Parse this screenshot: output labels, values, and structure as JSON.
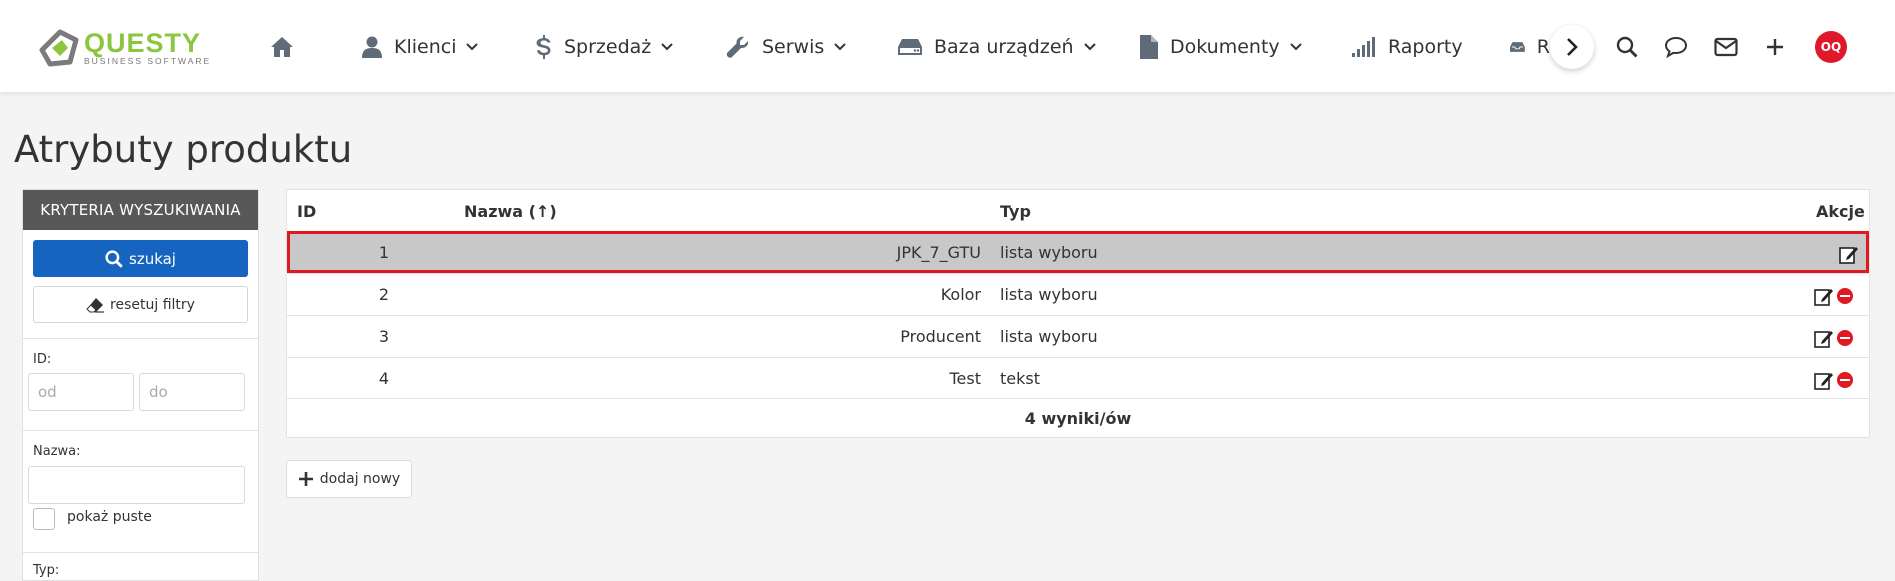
{
  "logo": {
    "word": "QUESTY",
    "sub": "BUSINESS SOFTWARE"
  },
  "nav": {
    "home_icon": "home-icon",
    "items": [
      {
        "label": "Klienci",
        "icon": "user-icon"
      },
      {
        "label": "Sprzedaż",
        "icon": "dollar-icon"
      },
      {
        "label": "Serwis",
        "icon": "wrench-icon"
      },
      {
        "label": "Baza urządzeń",
        "icon": "hdd-icon"
      },
      {
        "label": "Dokumenty",
        "icon": "file-icon"
      },
      {
        "label": "Raporty",
        "icon": "bars-icon"
      },
      {
        "label": "R",
        "icon": "inbox-icon"
      }
    ]
  },
  "user": {
    "initials": "OQ",
    "color": "#e0192a"
  },
  "page": {
    "title": "Atrybuty produktu"
  },
  "sidebar": {
    "header": "KRYTERIA WYSZUKIWANIA",
    "search_label": "szukaj",
    "reset_label": "resetuj filtry",
    "id_label": "ID:",
    "id_from_placeholder": "od",
    "id_to_placeholder": "do",
    "name_label": "Nazwa:",
    "name_value": "",
    "show_empty_label": "pokaż puste",
    "type_label": "Typ:"
  },
  "table": {
    "columns": {
      "id": "ID",
      "name": "Nazwa",
      "name_sort": "(↑)",
      "type": "Typ",
      "actions": "Akcje"
    },
    "rows": [
      {
        "id": "1",
        "name": "JPK_7_GTU",
        "type": "lista wyboru",
        "selected": true,
        "deletable": false
      },
      {
        "id": "2",
        "name": "Kolor",
        "type": "lista wyboru",
        "selected": false,
        "deletable": true
      },
      {
        "id": "3",
        "name": "Producent",
        "type": "lista wyboru",
        "selected": false,
        "deletable": true
      },
      {
        "id": "4",
        "name": "Test",
        "type": "tekst",
        "selected": false,
        "deletable": true
      }
    ],
    "footer": "4 wyniki/ów"
  },
  "add_button": {
    "label": "dodaj nowy"
  },
  "colors": {
    "primary": "#1565c0",
    "selection": "#e0181f",
    "logo": "#8cc63f"
  }
}
